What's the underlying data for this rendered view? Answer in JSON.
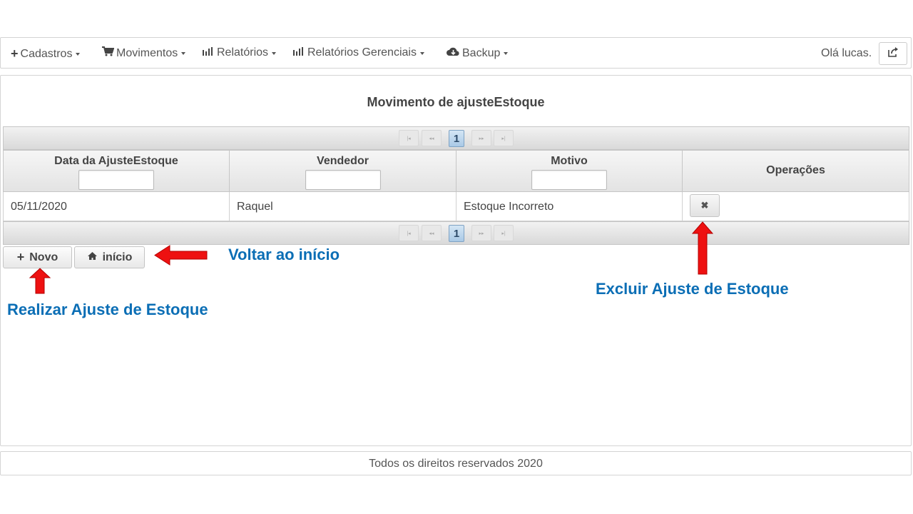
{
  "navbar": {
    "menus": [
      {
        "label": "Cadastros",
        "icon": "plus-icon"
      },
      {
        "label": "Movimentos",
        "icon": "cart-icon"
      },
      {
        "label": "Relatórios",
        "icon": "bar-chart-icon"
      },
      {
        "label": "Relatórios Gerenciais",
        "icon": "bar-chart-icon"
      },
      {
        "label": "Backup",
        "icon": "cloud-icon"
      }
    ],
    "greeting": "Olá lucas.",
    "logout_icon": "share-icon"
  },
  "page": {
    "title": "Movimento de ajusteEstoque"
  },
  "table": {
    "paginator_top": {
      "current_page": "1",
      "first": "|◂",
      "prev": "◂◂",
      "next": "▸▸",
      "last": "▸|"
    },
    "paginator_bottom": {
      "current_page": "1",
      "first": "|◂",
      "prev": "◂◂",
      "next": "▸▸",
      "last": "▸|"
    },
    "columns": [
      "Data da AjusteEstoque",
      "Vendedor",
      "Motivo",
      "Operações"
    ],
    "filters": [
      "",
      "",
      ""
    ],
    "rows": [
      {
        "date": "05/11/2020",
        "seller": "Raquel",
        "reason": "Estoque Incorreto",
        "delete_label": "✖"
      }
    ]
  },
  "buttons": {
    "novo": "Novo",
    "inicio": "início"
  },
  "annotations": {
    "voltar": "Voltar ao início",
    "excluir": "Excluir Ajuste de Estoque",
    "realizar": "Realizar Ajuste de Estoque",
    "arrow_color": "#ee1111"
  },
  "footer": {
    "text": "Todos os direitos reservados 2020"
  },
  "colors": {
    "annotation_text": "#0b6eb5",
    "paginator_current": "#a9c9e6"
  }
}
